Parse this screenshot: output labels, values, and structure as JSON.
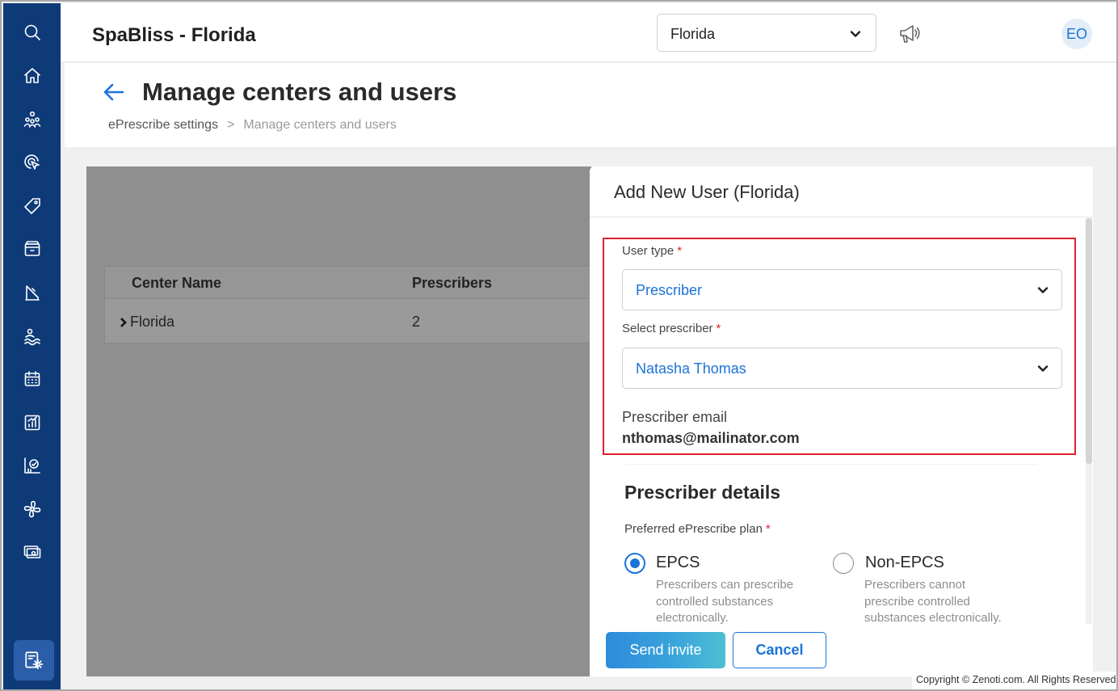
{
  "app": {
    "title": "SpaBliss - Florida"
  },
  "header": {
    "center_select": {
      "value": "Florida"
    },
    "avatar_initials": "EO"
  },
  "sidebar": {
    "items": [
      {
        "icon": "search-icon"
      },
      {
        "icon": "home-icon"
      },
      {
        "icon": "people-icon"
      },
      {
        "icon": "marketing-icon"
      },
      {
        "icon": "tag-icon"
      },
      {
        "icon": "box-icon"
      },
      {
        "icon": "reports-icon"
      },
      {
        "icon": "guest-icon"
      },
      {
        "icon": "calendar-icon"
      },
      {
        "icon": "analytics-icon"
      },
      {
        "icon": "insights-icon"
      },
      {
        "icon": "fan-icon"
      },
      {
        "icon": "payments-icon"
      }
    ],
    "active": {
      "icon": "settings-icon"
    }
  },
  "page": {
    "title": "Manage centers and users",
    "breadcrumb": {
      "parent": "ePrescribe settings",
      "separator": ">",
      "current": "Manage centers and users"
    }
  },
  "table": {
    "headers": [
      "Center Name",
      "Prescribers"
    ],
    "rows": [
      {
        "center": "Florida",
        "prescribers": "2"
      }
    ]
  },
  "panel": {
    "title": "Add New User (Florida)",
    "user_type": {
      "label": "User type",
      "required": "*",
      "value": "Prescriber"
    },
    "select_prescriber": {
      "label": "Select prescriber",
      "required": "*",
      "value": "Natasha Thomas"
    },
    "prescriber_email": {
      "label": "Prescriber email",
      "value": "nthomas@mailinator.com"
    },
    "details_title": "Prescriber details",
    "plan": {
      "label": "Preferred ePrescribe plan",
      "required": "*",
      "options": [
        {
          "title": "EPCS",
          "description": "Prescribers can prescribe controlled substances electronically.",
          "checked": true
        },
        {
          "title": "Non-EPCS",
          "description": "Prescribers cannot prescribe controlled substances electronically.",
          "checked": false
        }
      ]
    },
    "buttons": {
      "send": "Send invite",
      "cancel": "Cancel"
    }
  },
  "footer": {
    "copyright": "Copyright © Zenoti.com. All Rights Reserved"
  },
  "colors": {
    "sidebar": "#0f3a78",
    "accent": "#1a73d9",
    "highlight": "#e0212f",
    "overlay": "#8f8f8f"
  }
}
